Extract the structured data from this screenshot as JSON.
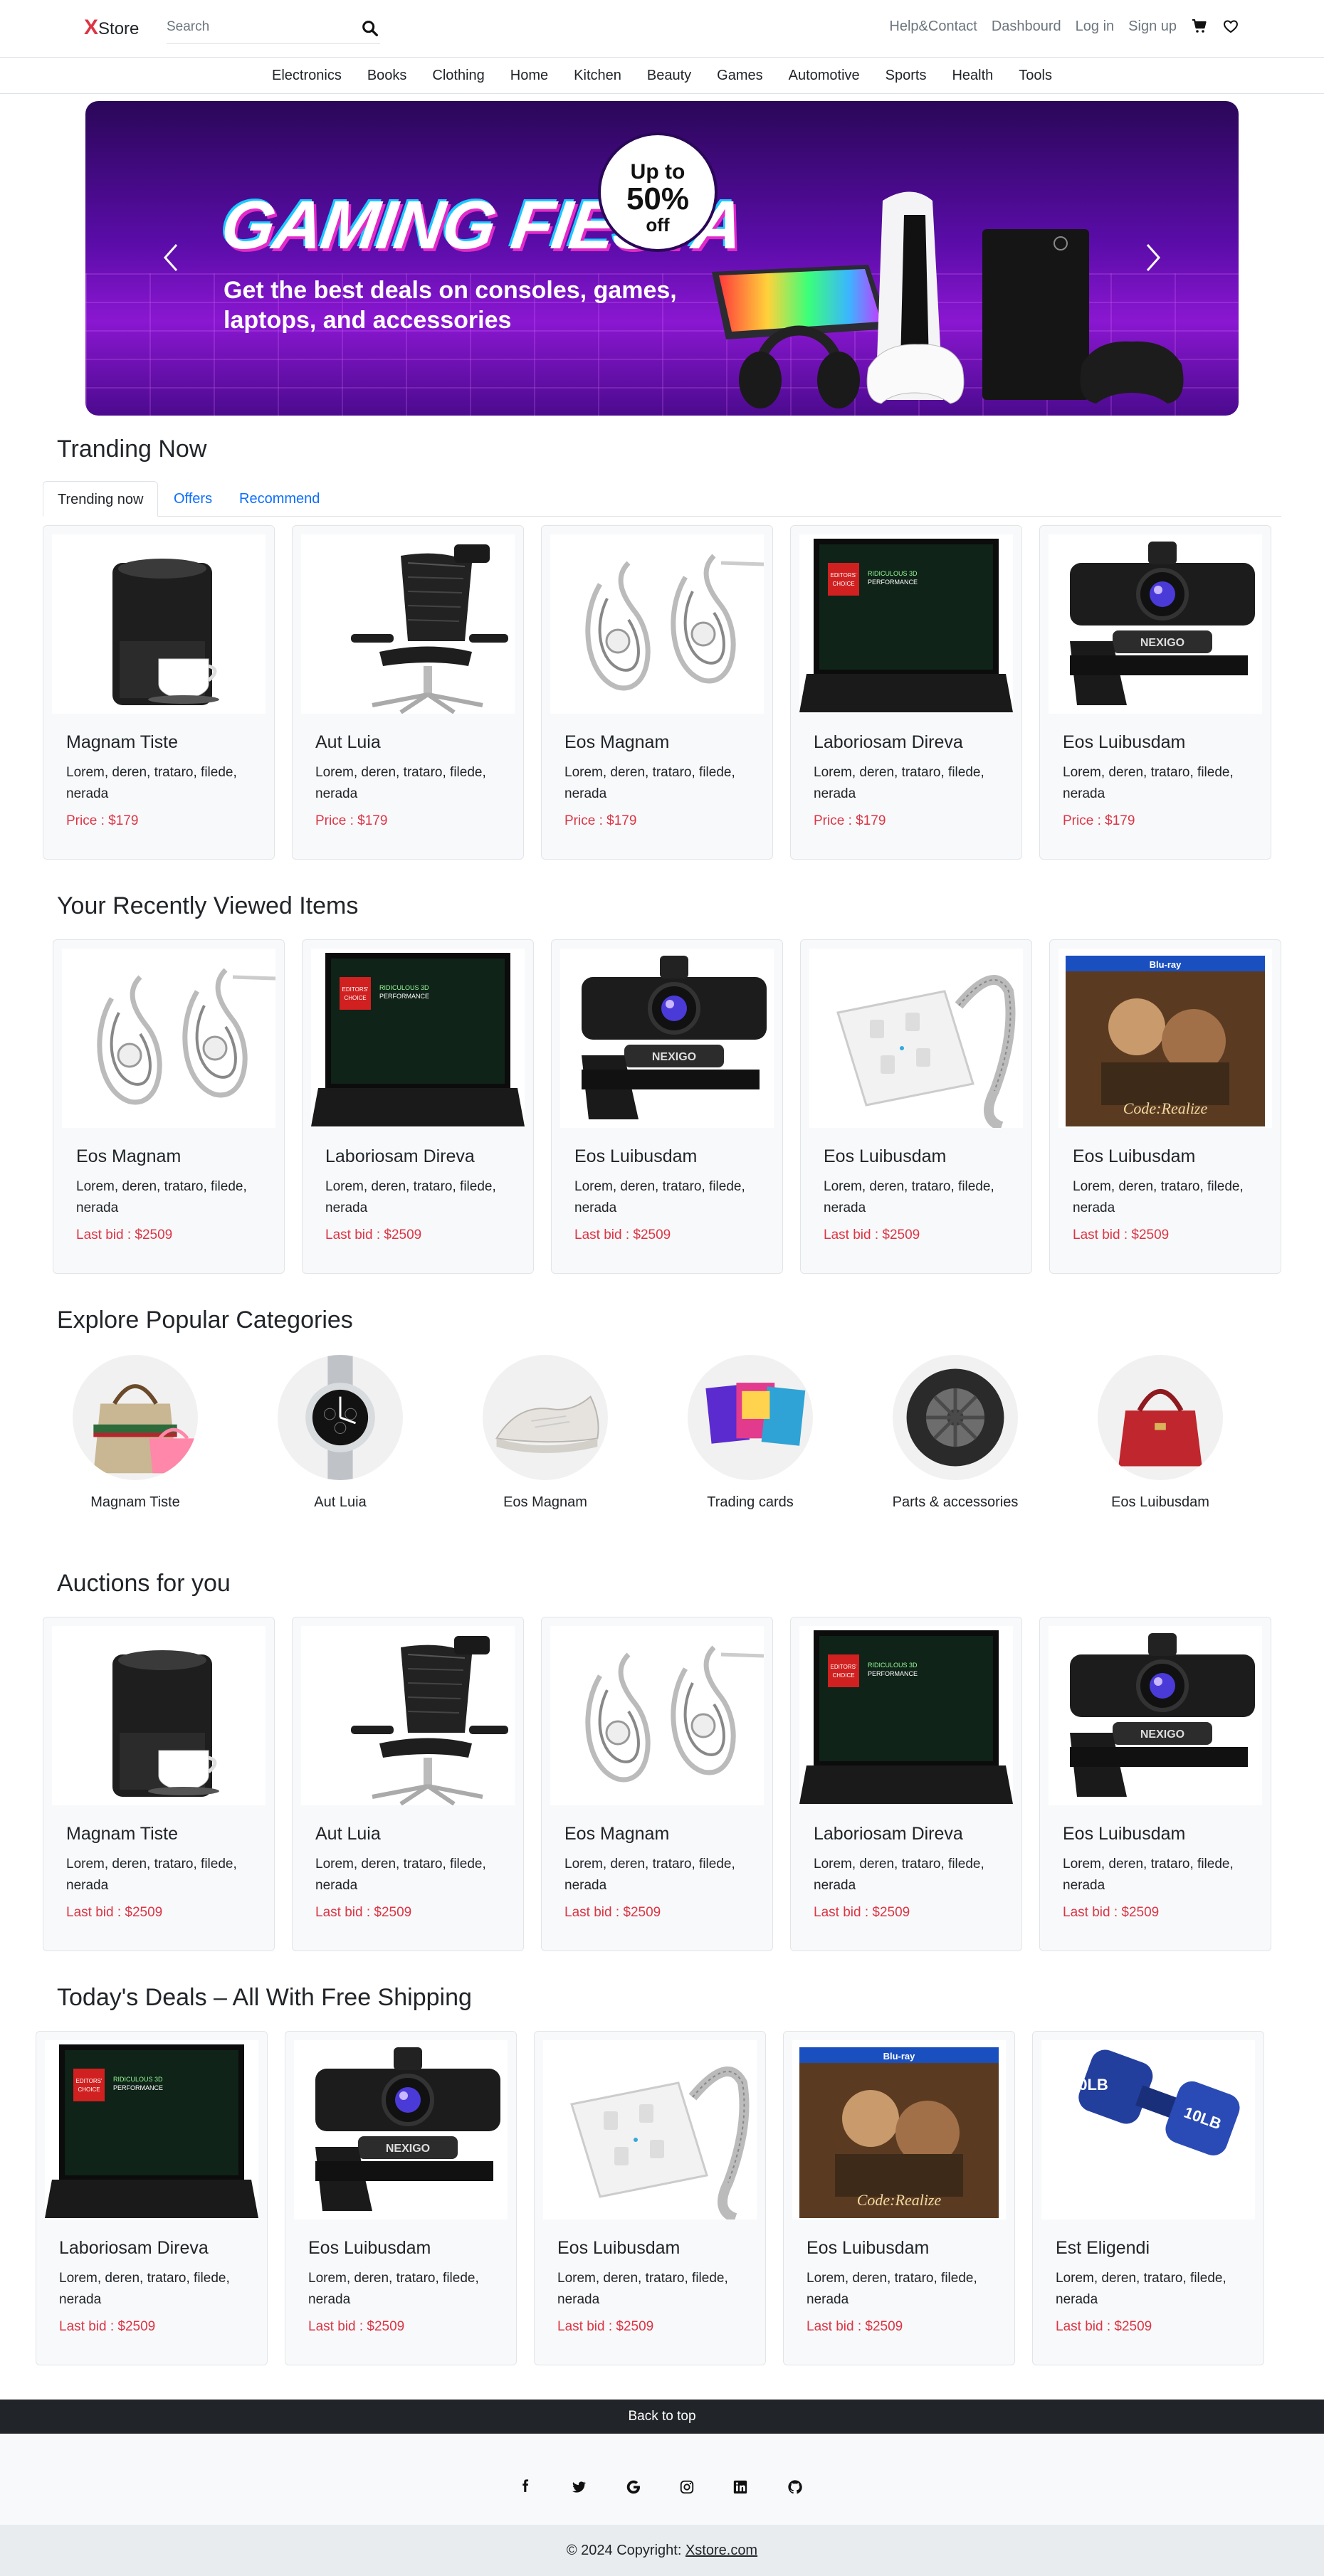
{
  "header": {
    "logo_x": "X",
    "logo_rest": "Store",
    "search_placeholder": "Search",
    "links": [
      "Help&Contact",
      "Dashbourd",
      "Log in",
      "Sign up"
    ]
  },
  "categories_nav": [
    "Electronics",
    "Books",
    "Clothing",
    "Home",
    "Kitchen",
    "Beauty",
    "Games",
    "Automotive",
    "Sports",
    "Health",
    "Tools"
  ],
  "banner": {
    "headline": "GAMING FIESTA",
    "subline": "Get the best deals on consoles, games, laptops, and accessories",
    "badge_top": "Up to",
    "badge_mid": "50%",
    "badge_bottom": "off"
  },
  "trending": {
    "title": "Tranding Now",
    "tabs": [
      "Trending now",
      "Offers",
      "Recommend"
    ],
    "items": [
      {
        "name": "Magnam Tiste",
        "desc": "Lorem, deren, trataro, filede, nerada",
        "price": "Price : $179",
        "image": "coffee-maker"
      },
      {
        "name": "Aut Luia",
        "desc": "Lorem, deren, trataro, filede, nerada",
        "price": "Price : $179",
        "image": "office-chair"
      },
      {
        "name": "Eos Magnam",
        "desc": "Lorem, deren, trataro, filede, nerada",
        "price": "Price : $179",
        "image": "earrings"
      },
      {
        "name": "Laboriosam Direva",
        "desc": "Lorem, deren, trataro, filede, nerada",
        "price": "Price : $179",
        "image": "laptop"
      },
      {
        "name": "Eos Luibusdam",
        "desc": "Lorem, deren, trataro, filede, nerada",
        "price": "Price : $179",
        "image": "webcam"
      }
    ]
  },
  "recent": {
    "title": "Your Recently Viewed Items",
    "items": [
      {
        "name": "Eos Magnam",
        "desc": "Lorem, deren, trataro, filede, nerada",
        "price": "Last bid : $2509",
        "image": "earrings"
      },
      {
        "name": "Laboriosam Direva",
        "desc": "Lorem, deren, trataro, filede, nerada",
        "price": "Last bid : $2509",
        "image": "laptop"
      },
      {
        "name": "Eos Luibusdam",
        "desc": "Lorem, deren, trataro, filede, nerada",
        "price": "Last bid : $2509",
        "image": "webcam"
      },
      {
        "name": "Eos Luibusdam",
        "desc": "Lorem, deren, trataro, filede, nerada",
        "price": "Last bid : $2509",
        "image": "power-strip"
      },
      {
        "name": "Eos Luibusdam",
        "desc": "Lorem, deren, trataro, filede, nerada",
        "price": "Last bid : $2509",
        "image": "bluray"
      }
    ]
  },
  "popular": {
    "title": "Explore Popular Categories",
    "items": [
      {
        "label": "Magnam Tiste",
        "image": "handbags"
      },
      {
        "label": "Aut Luia",
        "image": "watch"
      },
      {
        "label": "Eos Magnam",
        "image": "sneaker"
      },
      {
        "label": "Trading cards",
        "image": "cards"
      },
      {
        "label": "Parts & accessories",
        "image": "tire"
      },
      {
        "label": "Eos Luibusdam",
        "image": "red-bag"
      }
    ]
  },
  "auctions": {
    "title": "Auctions for you",
    "items": [
      {
        "name": "Magnam Tiste",
        "desc": "Lorem, deren, trataro, filede, nerada",
        "price": "Last bid : $2509",
        "image": "coffee-maker"
      },
      {
        "name": "Aut Luia",
        "desc": "Lorem, deren, trataro, filede, nerada",
        "price": "Last bid : $2509",
        "image": "office-chair"
      },
      {
        "name": "Eos Magnam",
        "desc": "Lorem, deren, trataro, filede, nerada",
        "price": "Last bid : $2509",
        "image": "earrings"
      },
      {
        "name": "Laboriosam Direva",
        "desc": "Lorem, deren, trataro, filede, nerada",
        "price": "Last bid : $2509",
        "image": "laptop"
      },
      {
        "name": "Eos Luibusdam",
        "desc": "Lorem, deren, trataro, filede, nerada",
        "price": "Last bid : $2509",
        "image": "webcam"
      }
    ]
  },
  "deals": {
    "title": "Today's Deals – All With Free Shipping",
    "items": [
      {
        "name": "Laboriosam Direva",
        "desc": "Lorem, deren, trataro, filede, nerada",
        "price": "Last bid : $2509",
        "image": "laptop"
      },
      {
        "name": "Eos Luibusdam",
        "desc": "Lorem, deren, trataro, filede, nerada",
        "price": "Last bid : $2509",
        "image": "webcam"
      },
      {
        "name": "Eos Luibusdam",
        "desc": "Lorem, deren, trataro, filede, nerada",
        "price": "Last bid : $2509",
        "image": "power-strip"
      },
      {
        "name": "Eos Luibusdam",
        "desc": "Lorem, deren, trataro, filede, nerada",
        "price": "Last bid : $2509",
        "image": "bluray"
      },
      {
        "name": "Est Eligendi",
        "desc": "Lorem, deren, trataro, filede, nerada",
        "price": "Last bid : $2509",
        "image": "dumbbells"
      }
    ]
  },
  "footer": {
    "back_to_top": "Back to top",
    "social": [
      "facebook-icon",
      "twitter-icon",
      "google-icon",
      "instagram-icon",
      "linkedin-icon",
      "github-icon"
    ],
    "copyright": "© 2024 Copyright:",
    "site_link": "Xstore.com"
  },
  "colors": {
    "accent": "#dc3545",
    "link": "#0d6efd",
    "dark": "#212529",
    "banner": "#5a0ca8"
  }
}
